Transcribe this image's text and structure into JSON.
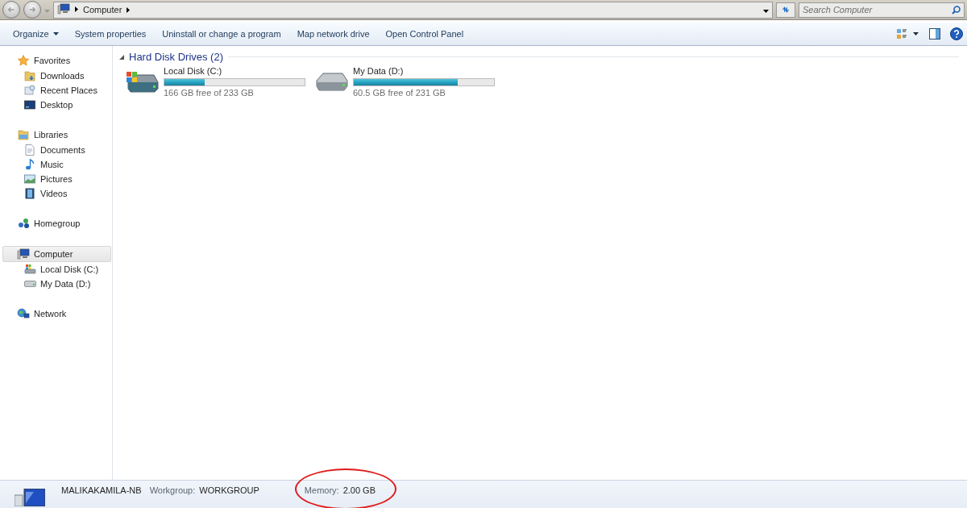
{
  "address_bar": {
    "crumbs": [
      "Computer"
    ]
  },
  "search": {
    "placeholder": "Search Computer"
  },
  "toolbar": {
    "buttons": [
      {
        "label": "Organize",
        "kind": "menu"
      },
      {
        "label": "System properties",
        "kind": "plain"
      },
      {
        "label": "Uninstall or change a program",
        "kind": "plain"
      },
      {
        "label": "Map network drive",
        "kind": "plain"
      },
      {
        "label": "Open Control Panel",
        "kind": "plain"
      }
    ]
  },
  "sidebar": {
    "groups": [
      {
        "label": "Favorites",
        "selected": false,
        "children": [
          {
            "label": "Downloads"
          },
          {
            "label": "Recent Places"
          },
          {
            "label": "Desktop"
          }
        ]
      },
      {
        "label": "Libraries",
        "selected": false,
        "children": [
          {
            "label": "Documents"
          },
          {
            "label": "Music"
          },
          {
            "label": "Pictures"
          },
          {
            "label": "Videos"
          }
        ]
      },
      {
        "label": "Homegroup",
        "selected": false
      },
      {
        "label": "Computer",
        "selected": true,
        "children": [
          {
            "label": "Local Disk (C:)"
          },
          {
            "label": "My Data (D:)"
          }
        ]
      },
      {
        "label": "Network",
        "selected": false
      }
    ]
  },
  "section": {
    "title": "Hard Disk Drives (2)",
    "expanded": true
  },
  "drives": [
    {
      "name": "Local Disk (C:)",
      "kind": "system",
      "level": 0.29,
      "free": "166 GB free of 233 GB"
    },
    {
      "name": "My Data (D:)",
      "kind": "data",
      "level": 0.74,
      "free": "60.5 GB free of 231 GB"
    }
  ],
  "details": {
    "computer_name": "MALIKAKAMILA-NB",
    "fields": [
      {
        "label": "Workgroup:",
        "value": "WORKGROUP",
        "annotated": false
      },
      {
        "label": "Memory:",
        "value": "2.00 GB",
        "annotated": true
      }
    ]
  }
}
